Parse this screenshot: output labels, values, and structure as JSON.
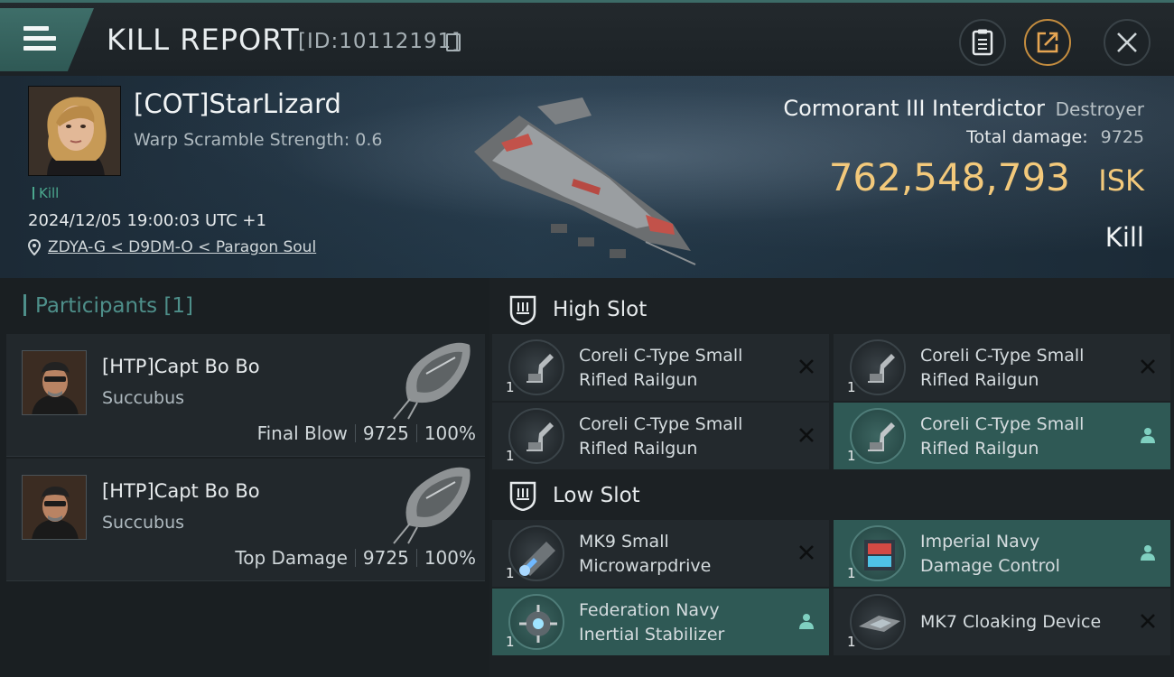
{
  "header": {
    "title": "KILL REPORT",
    "report_id": "[ID:10112191]",
    "menu_icon": "hamburger-menu-icon",
    "buttons": [
      "clipboard-icon",
      "share-icon",
      "close-icon"
    ]
  },
  "victim": {
    "pilot": "[COT]StarLizard",
    "warp_scramble": "Warp Scramble Strength: 0.6",
    "kill_tag": "Kill",
    "datetime": "2024/12/05 19:00:03 UTC +1",
    "location": "ZDYA-G < D9DM-O < Paragon Soul",
    "ship_name": "Cormorant III Interdictor",
    "ship_class": "Destroyer",
    "total_damage_label": "Total damage:",
    "total_damage": "9725",
    "isk_value": "762,548,793",
    "isk_unit": "ISK",
    "result": "Kill"
  },
  "participants": {
    "heading": "Participants [1]",
    "items": [
      {
        "name": "[HTP]Capt Bo Bo",
        "ship": "Succubus",
        "role": "Final Blow",
        "damage": "9725",
        "percent": "100%"
      },
      {
        "name": "[HTP]Capt Bo Bo",
        "ship": "Succubus",
        "role": "Top Damage",
        "damage": "9725",
        "percent": "100%"
      }
    ]
  },
  "slots": {
    "high": {
      "title": "High Slot",
      "modules": [
        {
          "line1": "Coreli C-Type Small",
          "line2": "Rifled Railgun",
          "qty": "1",
          "state": "destroyed"
        },
        {
          "line1": "Coreli C-Type Small",
          "line2": "Rifled Railgun",
          "qty": "1",
          "state": "destroyed"
        },
        {
          "line1": "Coreli C-Type Small",
          "line2": "Rifled Railgun",
          "qty": "1",
          "state": "destroyed"
        },
        {
          "line1": "Coreli C-Type Small",
          "line2": "Rifled Railgun",
          "qty": "1",
          "state": "dropped"
        }
      ]
    },
    "low": {
      "title": "Low Slot",
      "modules": [
        {
          "line1": "MK9 Small",
          "line2": "Microwarpdrive",
          "qty": "1",
          "state": "destroyed"
        },
        {
          "line1": "Imperial Navy",
          "line2": "Damage Control",
          "qty": "1",
          "state": "dropped"
        },
        {
          "line1": "Federation Navy",
          "line2": "Inertial Stabilizer",
          "qty": "1",
          "state": "dropped"
        },
        {
          "line1": "MK7 Cloaking Device",
          "line2": "",
          "qty": "1",
          "state": "destroyed"
        }
      ]
    }
  },
  "colors": {
    "accent": "#3e6e69",
    "isk": "#f3c97b",
    "kill_green": "#4ba88e",
    "fitted_bg": "#2f5955"
  }
}
